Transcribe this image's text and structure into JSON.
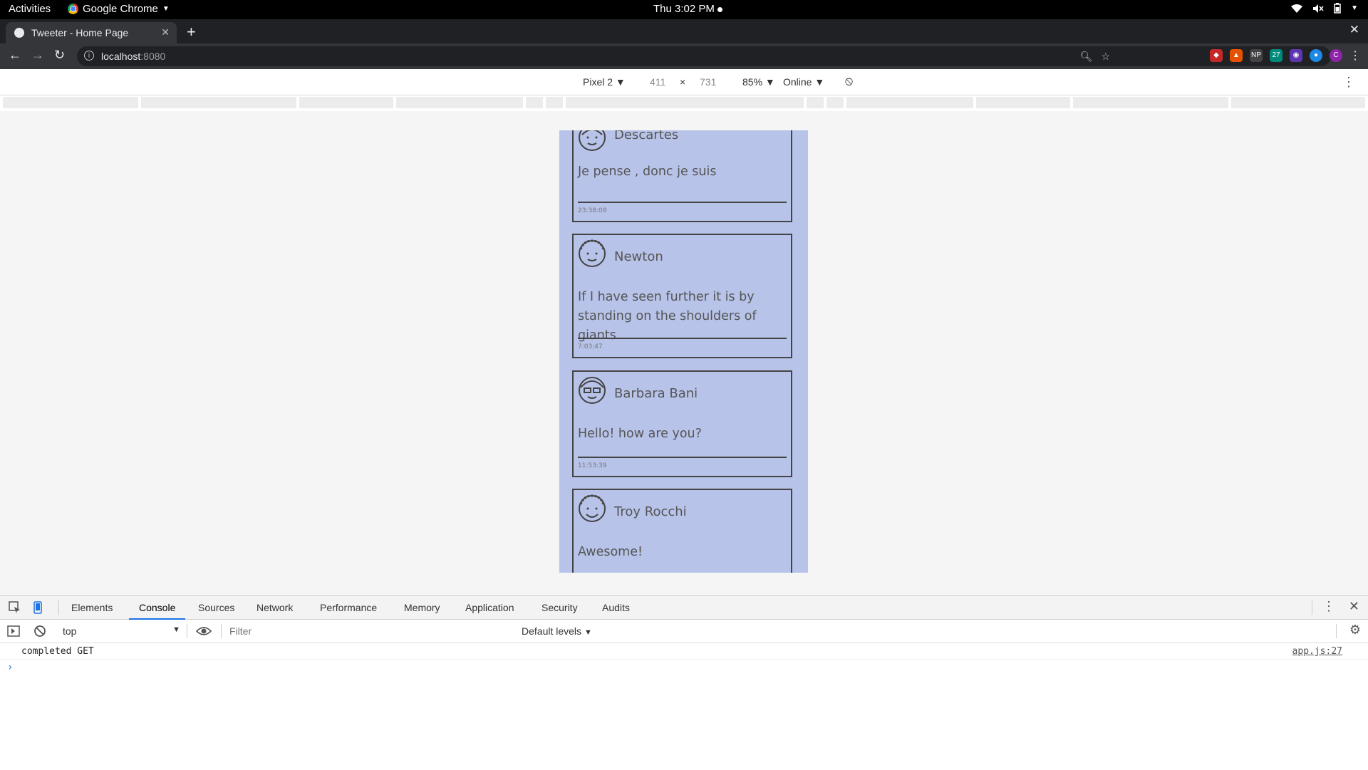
{
  "os": {
    "activities": "Activities",
    "app_name": "Google Chrome",
    "clock": "Thu  3:02 PM"
  },
  "browser": {
    "tab_title": "Tweeter - Home Page",
    "url_host": "localhost",
    "url_port": ":8080"
  },
  "device_toolbar": {
    "device": "Pixel 2",
    "width": "411",
    "times": "×",
    "height": "731",
    "zoom": "85%",
    "throttle": "Online"
  },
  "tweets": [
    {
      "name": "Descartes",
      "text": "Je pense , donc je suis",
      "time": "23:38:08"
    },
    {
      "name": "Newton",
      "text": "If I have seen further it is by standing on the shoulders of giants",
      "time": "7:03:47"
    },
    {
      "name": "Barbara Bani",
      "text": "Hello! how are you?",
      "time": "11:53:39"
    },
    {
      "name": "Troy Rocchi",
      "text": "Awesome!",
      "time": ""
    }
  ],
  "devtools": {
    "tabs": [
      "Elements",
      "Console",
      "Sources",
      "Network",
      "Performance",
      "Memory",
      "Application",
      "Security",
      "Audits"
    ],
    "context": "top",
    "filter_placeholder": "Filter",
    "levels": "Default levels",
    "messages": [
      {
        "text": "completed GET",
        "source": "app.js:27"
      }
    ],
    "prompt": "›"
  },
  "colors": {
    "phone_bg": "#b7c3e8",
    "accent": "#1a73e8"
  }
}
